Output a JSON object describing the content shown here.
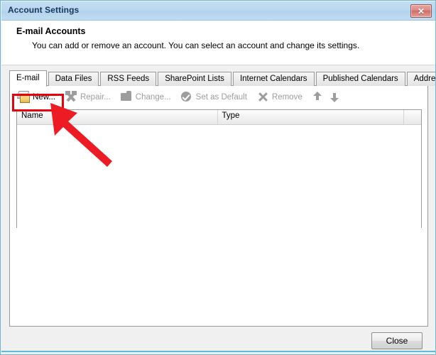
{
  "window": {
    "title": "Account Settings",
    "close_glyph": "✕",
    "close_icon_name": "window-close-icon"
  },
  "header": {
    "title": "E-mail Accounts",
    "subtitle": "You can add or remove an account. You can select an account and change its settings."
  },
  "tabs": [
    {
      "label": "E-mail",
      "selected": true
    },
    {
      "label": "Data Files",
      "selected": false
    },
    {
      "label": "RSS Feeds",
      "selected": false
    },
    {
      "label": "SharePoint Lists",
      "selected": false
    },
    {
      "label": "Internet Calendars",
      "selected": false
    },
    {
      "label": "Published Calendars",
      "selected": false
    },
    {
      "label": "Address Books",
      "selected": false
    }
  ],
  "toolbar": {
    "new_label": "New...",
    "repair_label": "Repair...",
    "change_label": "Change...",
    "set_default_label": "Set as Default",
    "remove_label": "Remove",
    "move_up_label": "",
    "move_down_label": ""
  },
  "list": {
    "columns": [
      "Name",
      "Type"
    ],
    "rows": []
  },
  "footer": {
    "close_label": "Close"
  },
  "annotation": {
    "highlight_target": "New...",
    "highlight_color": "#e8000d",
    "arrow_color": "#ed1c24"
  }
}
